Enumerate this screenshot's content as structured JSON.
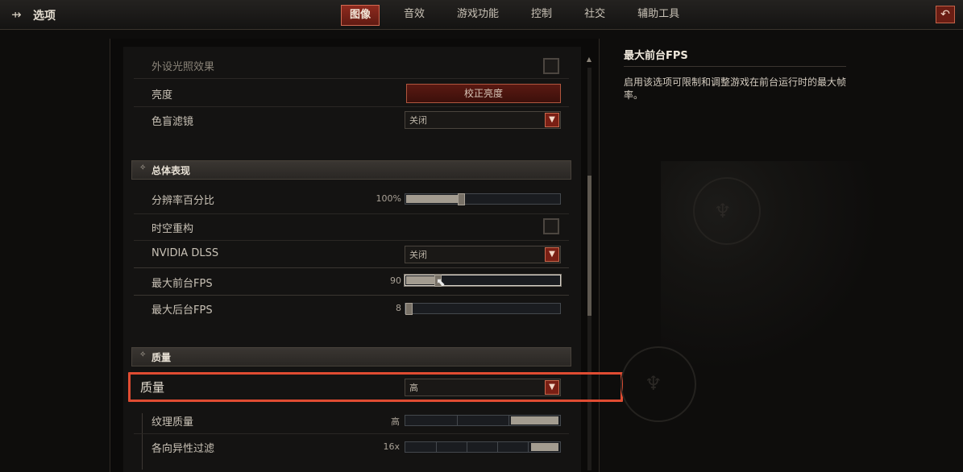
{
  "header": {
    "title": "选项",
    "tabs": [
      {
        "label": "图像",
        "active": true
      },
      {
        "label": "音效",
        "active": false
      },
      {
        "label": "游戏功能",
        "active": false
      },
      {
        "label": "控制",
        "active": false
      },
      {
        "label": "社交",
        "active": false
      },
      {
        "label": "辅助工具",
        "active": false
      }
    ]
  },
  "settings": {
    "ambient_label": "外设光照效果",
    "brightness_label": "亮度",
    "brightness_button": "校正亮度",
    "colorblind_label": "色盲滤镜",
    "colorblind_value": "关闭",
    "section_performance": "总体表现",
    "resolution_label": "分辨率百分比",
    "resolution_value": "100%",
    "resolution_fraction": 0.35,
    "temporal_label": "时空重构",
    "dlss_label": "NVIDIA DLSS",
    "dlss_value": "关闭",
    "fg_fps_label": "最大前台FPS",
    "fg_fps_value": "90",
    "fg_fps_fraction": 0.2,
    "bg_fps_label": "最大后台FPS",
    "bg_fps_value": "8",
    "bg_fps_fraction": 0.01,
    "section_quality": "质量",
    "quality_label": "质量",
    "quality_value": "高",
    "texture_label": "纹理质量",
    "texture_value": "高",
    "aniso_label": "各向异性过滤",
    "aniso_value": "16x"
  },
  "description": {
    "title": "最大前台FPS",
    "text": "启用该选项可限制和调整游戏在前台运行时的最大帧率。"
  },
  "colors": {
    "accent_red": "#7a1f14",
    "highlight": "#e04c32"
  }
}
